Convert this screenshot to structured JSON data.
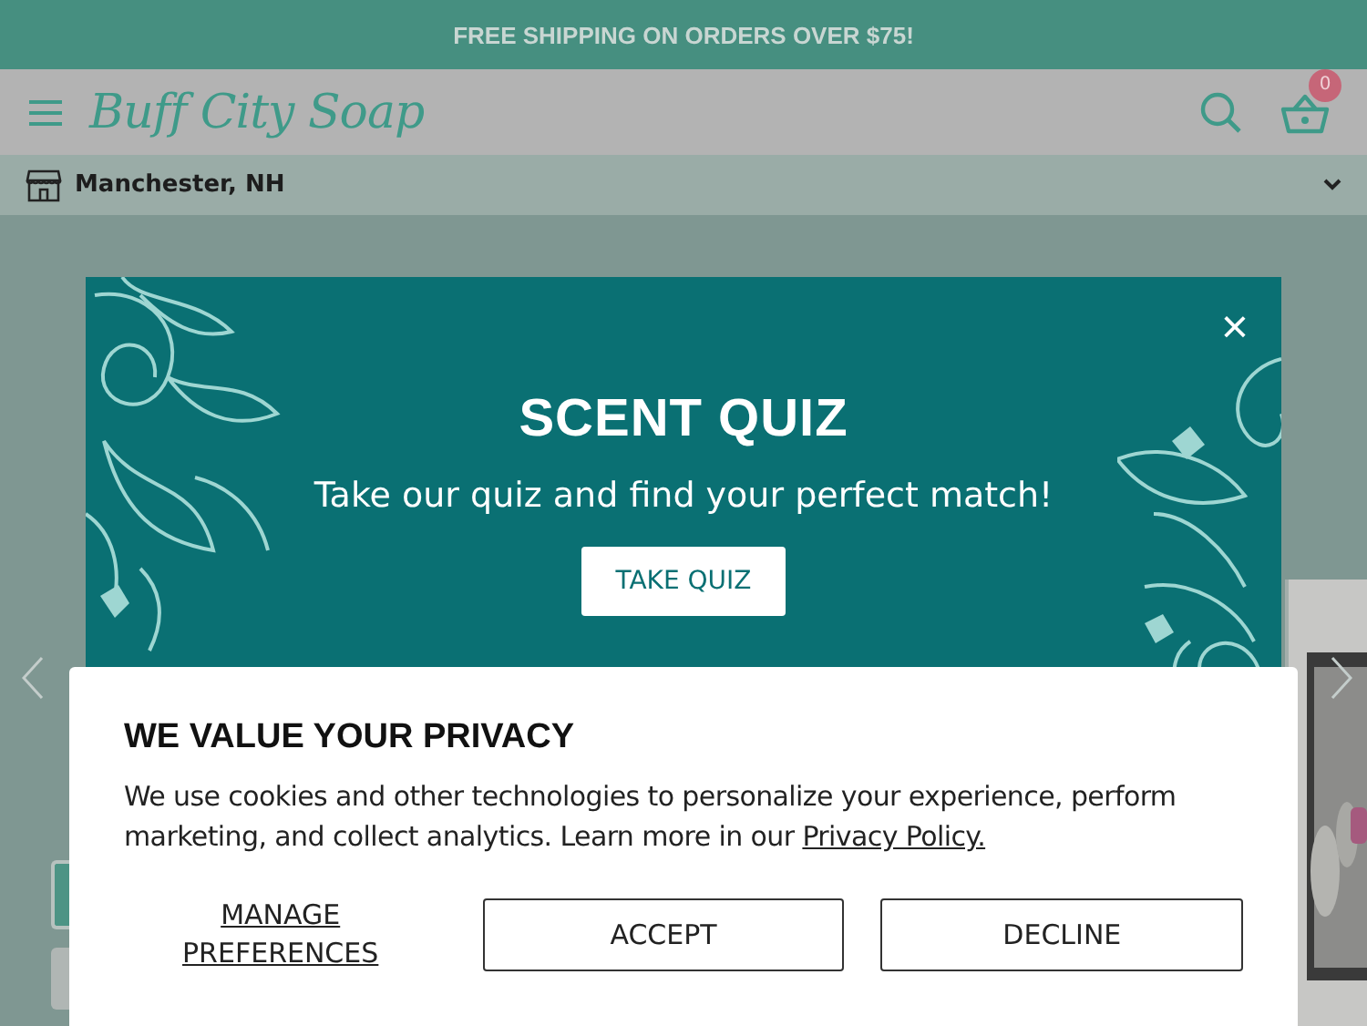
{
  "promo_bar": {
    "text": "FREE SHIPPING ON ORDERS OVER $75!"
  },
  "header": {
    "logo": "Buff City Soap",
    "cart_count": "0"
  },
  "location": {
    "text": "Manchester, NH"
  },
  "quiz_modal": {
    "title": "SCENT QUIZ",
    "subtitle": "Take our quiz and find your perfect match!",
    "button": "TAKE QUIZ",
    "close": "×"
  },
  "cookie_banner": {
    "title": "WE VALUE YOUR PRIVACY",
    "text": "We use cookies and other technologies to personalize your experience, perform marketing, and collect analytics. Learn more in our ",
    "link": "Privacy Policy.",
    "buttons": [
      {
        "kind": "link",
        "label": "MANAGE PREFERENCES"
      },
      {
        "kind": "outline",
        "label": "ACCEPT"
      },
      {
        "kind": "outline",
        "label": "DECLINE"
      }
    ]
  }
}
